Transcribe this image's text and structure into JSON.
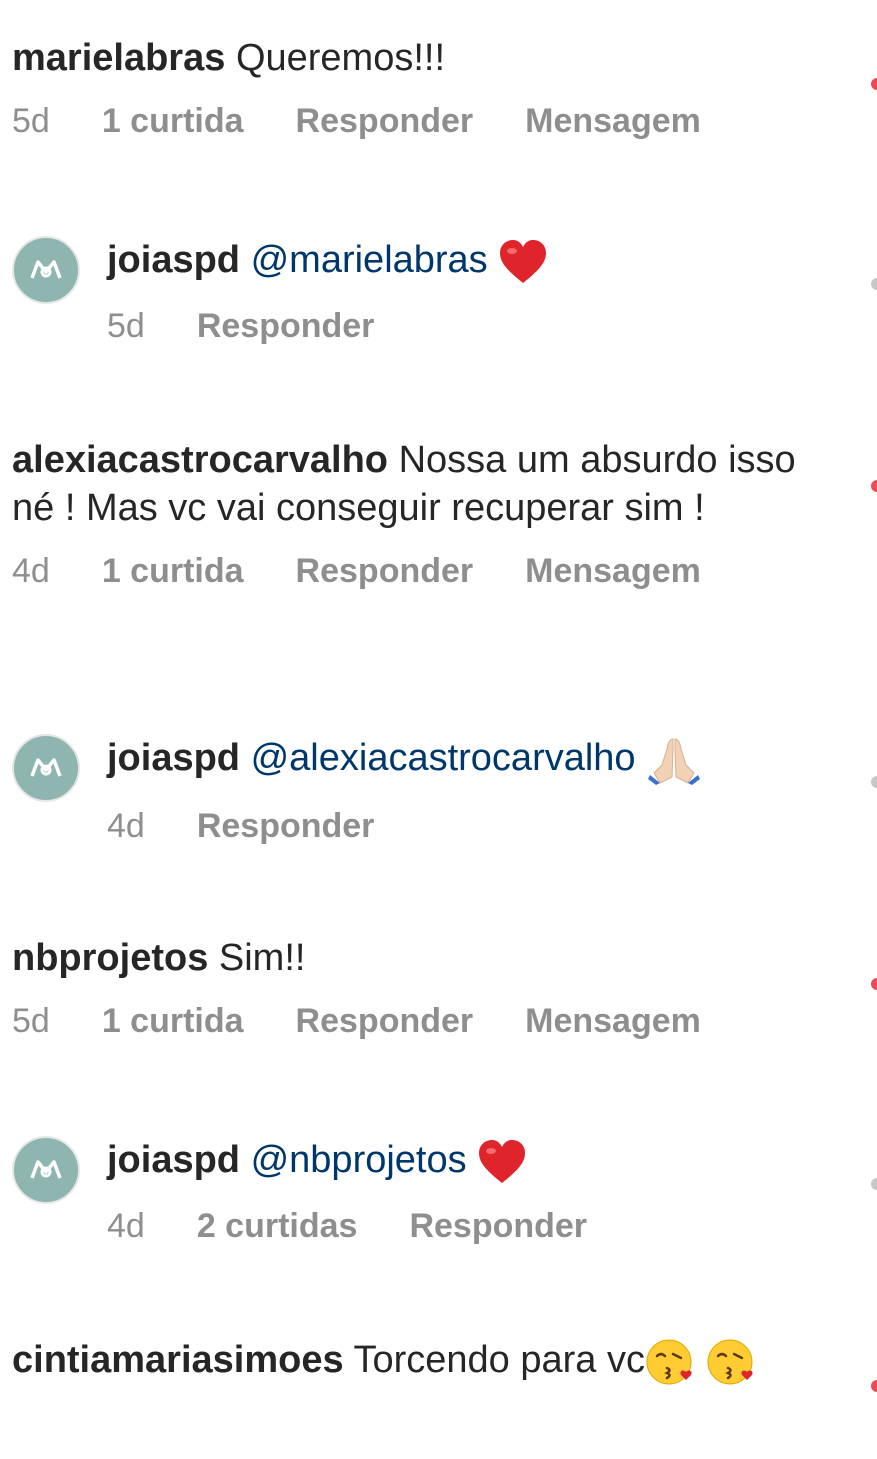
{
  "comments": [
    {
      "username": "marielabras",
      "text": "Queremos!!!",
      "time": "5d",
      "likes": "1 curtida",
      "reply_label": "Responder",
      "message_label": "Mensagem"
    },
    {
      "username": "joiaspd",
      "mention": "@marielabras",
      "emoji": "red-heart",
      "time": "5d",
      "reply_label": "Responder"
    },
    {
      "username": "alexiacastrocarvalho",
      "text": "Nossa um absurdo isso né ! Mas vc vai conseguir recuperar sim !",
      "time": "4d",
      "likes": "1 curtida",
      "reply_label": "Responder",
      "message_label": "Mensagem"
    },
    {
      "username": "joiaspd",
      "mention": "@alexiacastrocarvalho",
      "emoji": "folded-hands",
      "time": "4d",
      "reply_label": "Responder"
    },
    {
      "username": "nbprojetos",
      "text": "Sim!!",
      "time": "5d",
      "likes": "1 curtida",
      "reply_label": "Responder",
      "message_label": "Mensagem"
    },
    {
      "username": "joiaspd",
      "mention": "@nbprojetos",
      "emoji": "red-heart",
      "time": "4d",
      "likes": "2 curtidas",
      "reply_label": "Responder"
    },
    {
      "username": "cintiamariasimoes",
      "text": "Torcendo para vc",
      "emoji": "kissing-face"
    }
  ],
  "colors": {
    "username": "#262626",
    "mention": "#00376b",
    "meta": "#8e8e8e",
    "avatar_bg": "#8fb5b0",
    "heart": "#ed4956"
  }
}
